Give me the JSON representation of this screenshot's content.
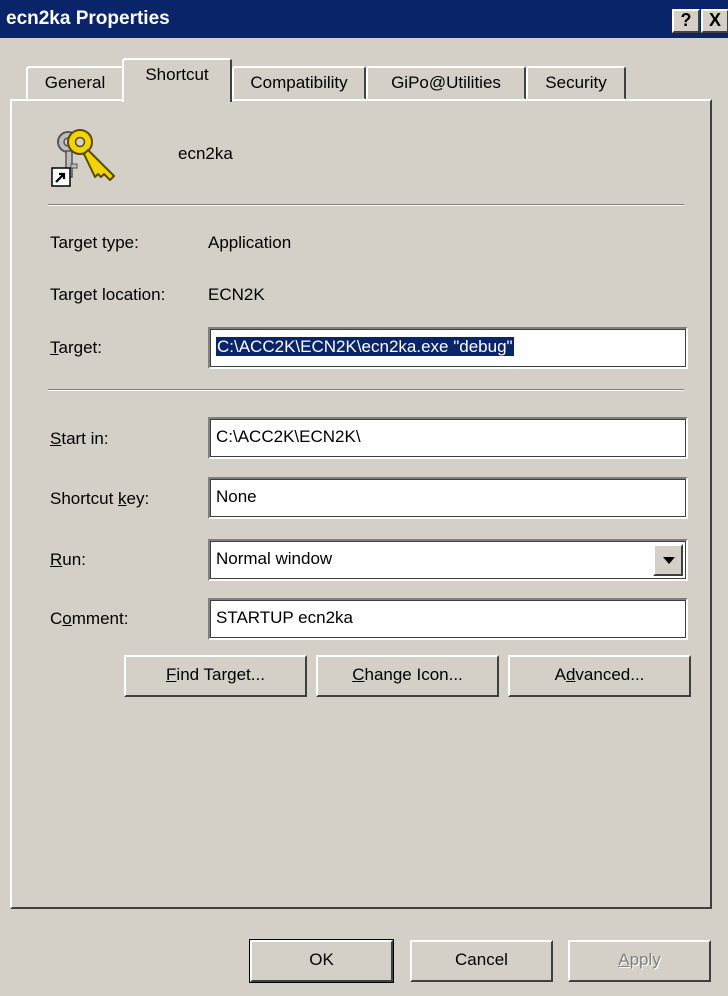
{
  "window": {
    "title": "ecn2ka Properties",
    "help_label": "?",
    "close_label": "X"
  },
  "tabs": [
    {
      "label": "General",
      "active": false
    },
    {
      "label": "Shortcut",
      "active": true
    },
    {
      "label": "Compatibility",
      "active": false
    },
    {
      "label": "GiPo@Utilities",
      "active": false
    },
    {
      "label": "Security",
      "active": false
    }
  ],
  "header": {
    "icon": "shortcut-keys-icon",
    "name": "ecn2ka"
  },
  "target_type": {
    "label": "Target type:",
    "value": "Application"
  },
  "target_location": {
    "label": "Target location:",
    "value": "ECN2K"
  },
  "target": {
    "label_underline": "T",
    "label_rest": "arget:",
    "value": "C:\\ACC2K\\ECN2K\\ecn2ka.exe \"debug\""
  },
  "start_in": {
    "label_underline": "S",
    "label_rest": "tart in:",
    "value": "C:\\ACC2K\\ECN2K\\"
  },
  "shortcut_key": {
    "label_before": "Shortcut ",
    "label_underline": "k",
    "label_rest": "ey:",
    "value": "None"
  },
  "run": {
    "label_underline": "R",
    "label_rest": "un:",
    "value": "Normal window"
  },
  "comment": {
    "label_before": "C",
    "label_underline": "o",
    "label_rest": "mment:",
    "value": "STARTUP ecn2ka"
  },
  "buttons": {
    "find_target": {
      "underline": "F",
      "rest": "ind Target..."
    },
    "change_icon": {
      "underline": "C",
      "rest": "hange Icon..."
    },
    "advanced": {
      "before": "A",
      "underline": "d",
      "rest": "vanced..."
    }
  },
  "footer": {
    "ok": "OK",
    "cancel": "Cancel",
    "apply_underline": "A",
    "apply_rest": "pply"
  },
  "colors": {
    "titlebar": "#0a246a",
    "dialog": "#d4d0c8",
    "selection": "#0a246a"
  }
}
